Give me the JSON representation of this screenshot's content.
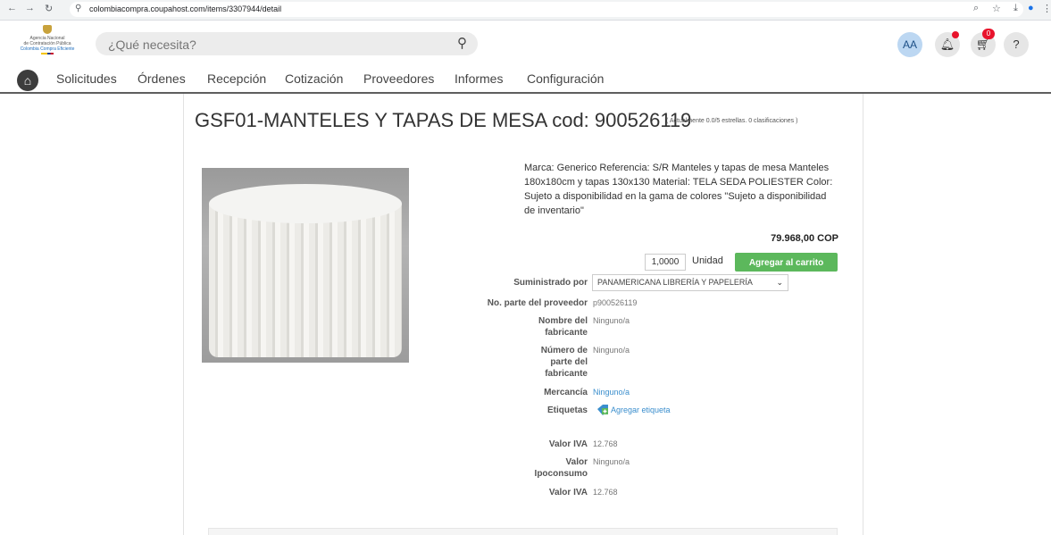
{
  "browser": {
    "url": "colombiacompra.coupahost.com/items/3307944/detail"
  },
  "logo": {
    "line1": "Agencia Nacional",
    "line2": "de Contratación Pública",
    "line3": "Colombia Compra Eficiente"
  },
  "header": {
    "search_placeholder": "¿Qué necesita?",
    "avatar_initials": "AA",
    "cart_count": "0",
    "help_label": "?"
  },
  "nav": {
    "items": [
      "Solicitudes",
      "Órdenes",
      "Recepción",
      "Cotización",
      "Proveedores",
      "Informes",
      "Configuración"
    ]
  },
  "product": {
    "title": "GSF01-MANTELES Y TAPAS DE MESA cod: 900526119",
    "rating": "( Actualmente 0.0/5 estrellas. 0 clasificaciones )",
    "description": "Marca: Generico Referencia: S/R Manteles y tapas de mesa Manteles 180x180cm y tapas 130x130 Material: TELA SEDA POLIESTER Color: Sujeto a disponibilidad en la gama de colores \"Sujeto a disponibilidad de inventario\"",
    "price": "79.968,00 COP",
    "quantity": "1,0000",
    "unit": "Unidad",
    "add_to_cart": "Agregar al carrito"
  },
  "details": {
    "supplier_label": "Suministrado por",
    "supplier_value": "PANAMERICANA LIBRERÍA Y PAPELERÍA",
    "supplier_part_label": "No. parte del proveedor",
    "supplier_part_value": "p900526119",
    "manufacturer_label_1": "Nombre del",
    "manufacturer_label_2": "fabricante",
    "manufacturer_value": "Ninguno/a",
    "mfr_part_label_1": "Número de",
    "mfr_part_label_2": "parte del",
    "mfr_part_label_3": "fabricante",
    "mfr_part_value": "Ninguno/a",
    "commodity_label": "Mercancía",
    "commodity_value": "Ninguno/a",
    "tags_label": "Etiquetas",
    "tags_action": "Agregar etiqueta",
    "iva_label": "Valor IVA",
    "iva_value": "12.768",
    "ipoconsumo_label_1": "Valor",
    "ipoconsumo_label_2": "Ipoconsumo",
    "ipoconsumo_value": "Ninguno/a",
    "iva2_label": "Valor IVA",
    "iva2_value": "12.768"
  },
  "colors": {
    "accent_green": "#5cb85c",
    "link_blue": "#3a8ecd",
    "badge_red": "#e8132c"
  }
}
